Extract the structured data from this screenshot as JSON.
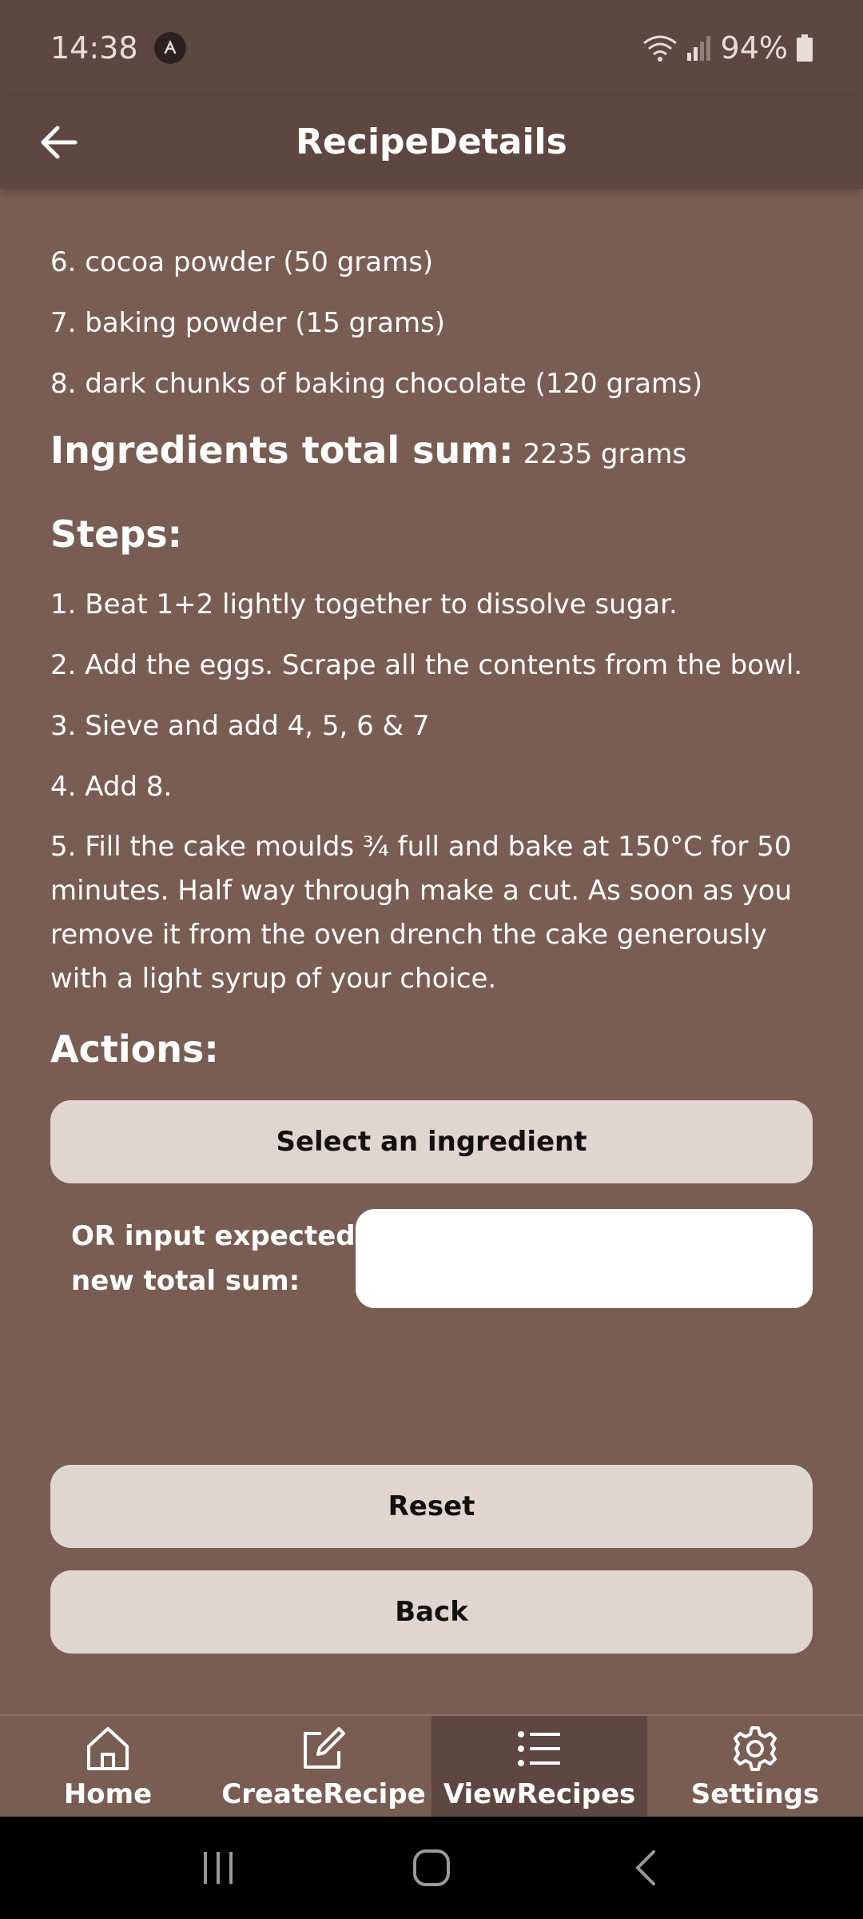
{
  "status_bar": {
    "time": "14:38",
    "battery": "94%"
  },
  "app_bar": {
    "title": "RecipeDetails"
  },
  "ingredients": [
    "6. cocoa powder (50 grams)",
    "7. baking powder (15 grams)",
    "8. dark chunks of baking chocolate (120 grams)"
  ],
  "total": {
    "label": "Ingredients total sum:",
    "value": "2235 grams"
  },
  "steps_heading": "Steps:",
  "steps": [
    "1. Beat 1+2 lightly together to dissolve sugar.",
    "2. Add the eggs. Scrape all the contents from the bowl.",
    "3. Sieve and add 4, 5, 6 & 7",
    "4. Add 8.",
    "5. Fill the cake moulds ¾ full and bake at 150°C for 50 minutes. Half way through make a cut. As soon as you remove it from the oven drench the cake generously with a light syrup of your choice."
  ],
  "actions_heading": "Actions:",
  "actions": {
    "select_ingredient": "Select an ingredient",
    "input_label": "OR input expected new total sum:",
    "input_value": "",
    "reset": "Reset",
    "back": "Back"
  },
  "bottom_nav": [
    {
      "label": "Home",
      "icon": "home-icon"
    },
    {
      "label": "CreateRecipe",
      "icon": "edit-icon"
    },
    {
      "label": "ViewRecipes",
      "icon": "list-icon",
      "active": true
    },
    {
      "label": "Settings",
      "icon": "gear-icon"
    }
  ]
}
